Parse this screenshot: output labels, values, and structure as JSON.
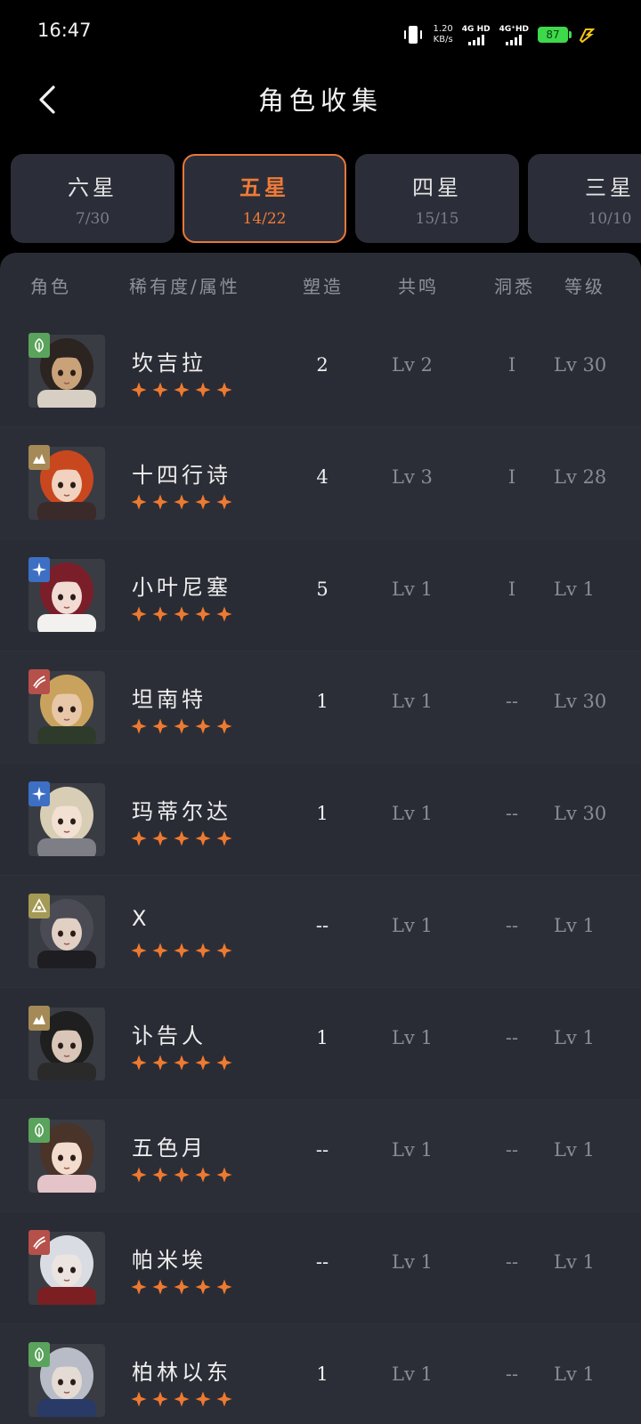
{
  "status": {
    "time": "16:47",
    "net_speed_value": "1.20",
    "net_speed_unit": "KB/s",
    "sim1": "4G HD",
    "sim2": "4G⁺HD",
    "battery": "87"
  },
  "header": {
    "title": "角色收集"
  },
  "tabs": [
    {
      "name": "六星",
      "count": "7/30",
      "active": false
    },
    {
      "name": "五星",
      "count": "14/22",
      "active": true
    },
    {
      "name": "四星",
      "count": "15/15",
      "active": false
    },
    {
      "name": "三星",
      "count": "10/10",
      "active": false
    }
  ],
  "columns": {
    "character": "角色",
    "rarity_attr": "稀有度/属性",
    "forge": "塑造",
    "resonance": "共鸣",
    "insight": "洞悉",
    "level": "等级"
  },
  "rows": [
    {
      "name": "坎吉拉",
      "forge": "2",
      "resonance": "Lv 2",
      "insight": "I",
      "level": "Lv 30",
      "element": "leaf",
      "element_color": "#5aa35c",
      "hair": "#2b2420",
      "skin": "#c9a27a",
      "cloth": "#d7cfc4"
    },
    {
      "name": "十四行诗",
      "forge": "4",
      "resonance": "Lv 3",
      "insight": "I",
      "level": "Lv 28",
      "element": "rock",
      "element_color": "#a58a57",
      "hair": "#c9471f",
      "skin": "#f0d2be",
      "cloth": "#3b2a2a"
    },
    {
      "name": "小叶尼塞",
      "forge": "5",
      "resonance": "Lv 1",
      "insight": "I",
      "level": "Lv 1",
      "element": "star",
      "element_color": "#3d6fc4",
      "hair": "#7a1f2a",
      "skin": "#f1dbd3",
      "cloth": "#f3f0f0"
    },
    {
      "name": "坦南特",
      "forge": "1",
      "resonance": "Lv 1",
      "insight": "--",
      "level": "Lv 30",
      "element": "beast",
      "element_color": "#b6504a",
      "hair": "#c9a35e",
      "skin": "#e7c7a8",
      "cloth": "#2f3b2a"
    },
    {
      "name": "玛蒂尔达",
      "forge": "1",
      "resonance": "Lv 1",
      "insight": "--",
      "level": "Lv 30",
      "element": "star",
      "element_color": "#3d6fc4",
      "hair": "#d8cdb5",
      "skin": "#f2e0d3",
      "cloth": "#7e7f86"
    },
    {
      "name": "X",
      "forge": "--",
      "resonance": "Lv 1",
      "insight": "--",
      "level": "Lv 1",
      "element": "spirit",
      "element_color": "#a59a55",
      "hair": "#4a4b55",
      "skin": "#e2d0c4",
      "cloth": "#1d1d22"
    },
    {
      "name": "讣告人",
      "forge": "1",
      "resonance": "Lv 1",
      "insight": "--",
      "level": "Lv 1",
      "element": "rock",
      "element_color": "#a58a57",
      "hair": "#1f1f1f",
      "skin": "#d9c6b8",
      "cloth": "#2a2a2a"
    },
    {
      "name": "五色月",
      "forge": "--",
      "resonance": "Lv 1",
      "insight": "--",
      "level": "Lv 1",
      "element": "leaf",
      "element_color": "#5aa35c",
      "hair": "#4a3328",
      "skin": "#f3dccd",
      "cloth": "#e4c4c9"
    },
    {
      "name": "帕米埃",
      "forge": "--",
      "resonance": "Lv 1",
      "insight": "--",
      "level": "Lv 1",
      "element": "beast",
      "element_color": "#b6504a",
      "hair": "#dadce3",
      "skin": "#ece4e0",
      "cloth": "#7c1f22"
    },
    {
      "name": "柏林以东",
      "forge": "1",
      "resonance": "Lv 1",
      "insight": "--",
      "level": "Lv 1",
      "element": "leaf",
      "element_color": "#5aa35c",
      "hair": "#b8bcc6",
      "skin": "#e5dbd5",
      "cloth": "#2a3a66"
    }
  ],
  "colors": {
    "accent": "#f07b37",
    "star": "#ee7a30",
    "panel": "#2a2c35"
  }
}
